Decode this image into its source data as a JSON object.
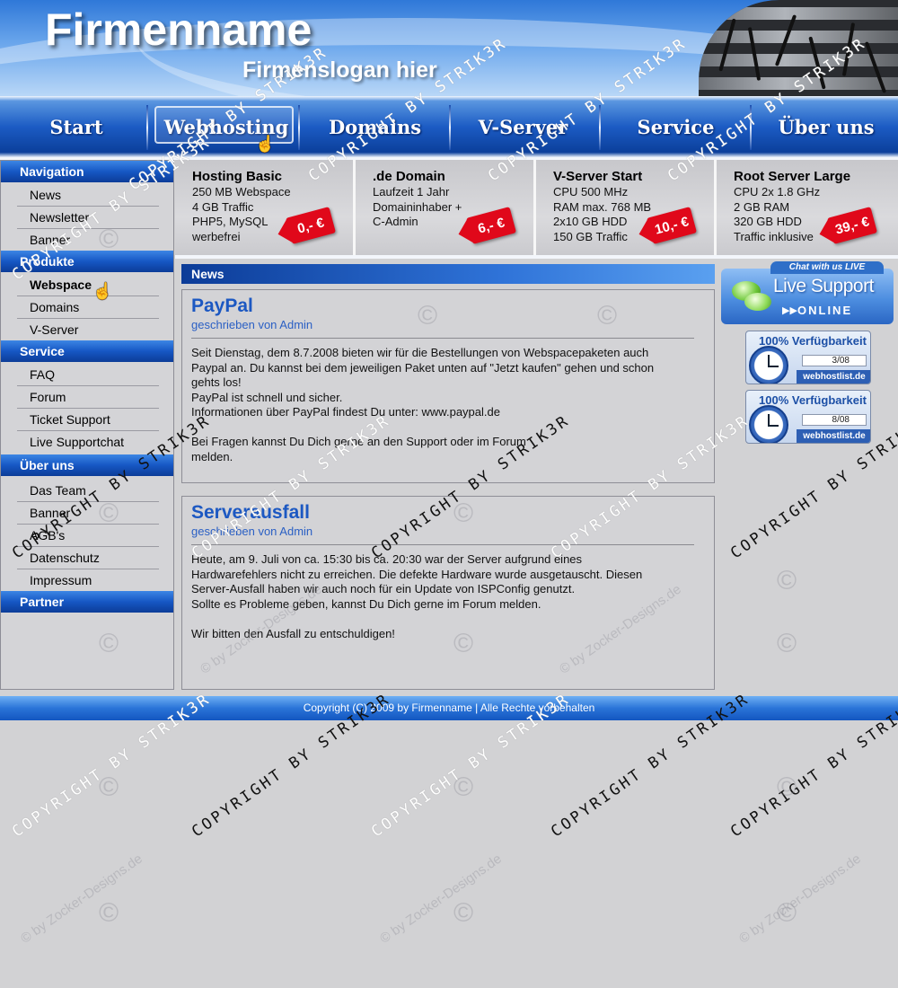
{
  "header": {
    "company": "Firmenname",
    "slogan": "Firmenslogan hier"
  },
  "nav": {
    "items": [
      {
        "label": "Start"
      },
      {
        "label": "Webhosting",
        "active": true
      },
      {
        "label": "Domains"
      },
      {
        "label": "V-Server"
      },
      {
        "label": "Service"
      },
      {
        "label": "Über uns"
      }
    ]
  },
  "sidebar": {
    "sections": [
      {
        "title": "Navigation",
        "items": [
          "News",
          "Newsletter",
          "Banner"
        ]
      },
      {
        "title": "Produkte",
        "items": [
          "Webspace",
          "Domains",
          "V-Server"
        ]
      },
      {
        "title": "Service",
        "items": [
          "FAQ",
          "Forum",
          "Ticket Support",
          "Live Supportchat"
        ]
      },
      {
        "title": "Über uns",
        "items": [
          "Das Team",
          "Banner",
          "AGB's",
          "Datenschutz",
          "Impressum"
        ]
      },
      {
        "title": "Partner",
        "items": []
      }
    ]
  },
  "products": [
    {
      "title": "Hosting Basic",
      "lines": [
        "250 MB Webspace",
        "4 GB Traffic",
        "PHP5, MySQL",
        "werbefrei"
      ],
      "price": "0,- €"
    },
    {
      "title": ".de Domain",
      "lines": [
        "Laufzeit 1 Jahr",
        "Domaininhaber +",
        "C-Admin"
      ],
      "price": "6,- €"
    },
    {
      "title": "V-Server Start",
      "lines": [
        "CPU 500 MHz",
        "RAM max. 768 MB",
        "2x10 GB HDD",
        "150 GB Traffic"
      ],
      "price": "10,- €"
    },
    {
      "title": "Root Server Large",
      "lines": [
        "CPU 2x 1.8 GHz",
        "2 GB RAM",
        "320 GB HDD",
        "Traffic inklusive"
      ],
      "price": "39,- €"
    }
  ],
  "news": {
    "heading": "News",
    "posts": [
      {
        "title": "PayPal",
        "meta": "geschrieben von Admin",
        "body": "Seit Dienstag, dem 8.7.2008 bieten wir für die Bestellungen von Webspacepaketen auch\nPaypal an. Du kannst bei dem jeweiligen Paket unten auf \"Jetzt kaufen\" gehen und schon\ngehts los!\nPayPal ist schnell und sicher.\nInformationen über PayPal findest Du unter: www.paypal.de\n\nBei Fragen kannst Du Dich gerne an den Support oder im Forum\nmelden."
      },
      {
        "title": "Serverausfall",
        "meta": "geschrieben von Admin",
        "body": "Heute, am 9. Juli von ca. 15:30 bis ca. 20:30 war der Server aufgrund eines\nHardwarefehlers nicht zu erreichen. Die defekte Hardware wurde ausgetauscht. Diesen\nServer-Ausfall haben wir auch noch für ein Update von ISPConfig genutzt.\nSollte es Probleme geben, kannst Du Dich gerne im Forum melden.\n\nWir bitten den Ausfall zu entschuldigen!"
      }
    ]
  },
  "livesupport": {
    "tab": "Chat with us LIVE",
    "title": "Live Support",
    "status": "ONLINE"
  },
  "availability": [
    {
      "title": "100% Verfügbarkeit",
      "month": "3/08",
      "site": "webhostlist.de"
    },
    {
      "title": "100% Verfügbarkeit",
      "month": "8/08",
      "site": "webhostlist.de"
    }
  ],
  "footer": {
    "text": "Copyright (C) 2009 by Firmenname | Alle Rechte vorbehalten"
  },
  "watermark": {
    "copyright": "COPYRIGHT BY STRIK3R",
    "zocker": "© by Zocker-Designs.de",
    "circle": "©"
  },
  "colors": {
    "accent": "#1657c4",
    "price": "#e0081a",
    "link": "#1c58c2"
  }
}
